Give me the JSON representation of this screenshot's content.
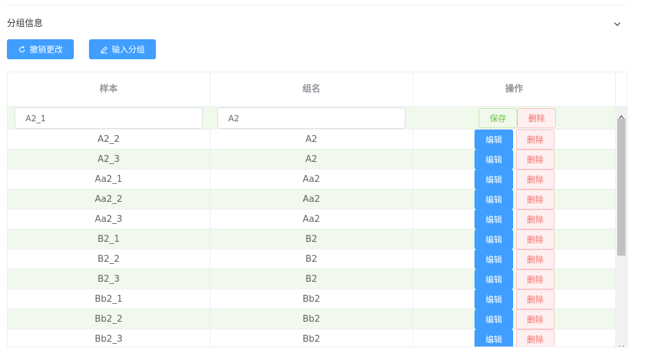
{
  "section": {
    "title": "分组信息",
    "toggle_icon": "chevron-down-icon"
  },
  "toolbar": {
    "revert_label": "撤销更改",
    "revert_icon": "refresh-icon",
    "import_label": "输入分组",
    "import_icon": "edit-icon"
  },
  "table": {
    "headers": [
      "样本",
      "组名",
      "操作"
    ],
    "edit_row": {
      "sample": "A2_1",
      "group": "A2",
      "save_label": "保存",
      "delete_label": "删除"
    },
    "rows": [
      {
        "sample": "A2_2",
        "group": "A2"
      },
      {
        "sample": "A2_3",
        "group": "A2"
      },
      {
        "sample": "Aa2_1",
        "group": "Aa2"
      },
      {
        "sample": "Aa2_2",
        "group": "Aa2"
      },
      {
        "sample": "Aa2_3",
        "group": "Aa2"
      },
      {
        "sample": "B2_1",
        "group": "B2"
      },
      {
        "sample": "B2_2",
        "group": "B2"
      },
      {
        "sample": "B2_3",
        "group": "B2"
      },
      {
        "sample": "Bb2_1",
        "group": "Bb2"
      },
      {
        "sample": "Bb2_2",
        "group": "Bb2"
      },
      {
        "sample": "Bb2_3",
        "group": "Bb2"
      }
    ],
    "edit_label": "编辑",
    "delete_label": "删除"
  },
  "colors": {
    "primary": "#409eff",
    "stripe": "#f0f9eb",
    "danger": "#f56c6c",
    "success": "#67c23a"
  }
}
